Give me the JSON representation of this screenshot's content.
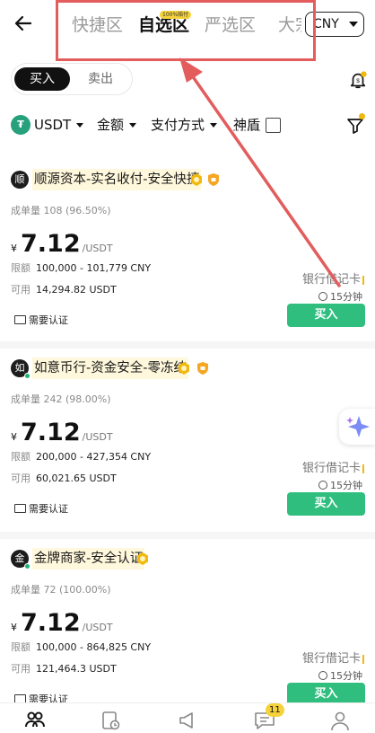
{
  "header": {
    "tabs": [
      {
        "label": "快捷区",
        "active": false
      },
      {
        "label": "自选区",
        "active": true
      },
      {
        "label": "严选区",
        "active": false,
        "badge": "100%赔付"
      },
      {
        "label": "大宗",
        "active": false
      }
    ],
    "currency": "CNY"
  },
  "trade_toggle": {
    "buy_label": "买入",
    "sell_label": "卖出",
    "selected": "买入"
  },
  "filters": {
    "asset": "USDT",
    "amount": "金额",
    "payment": "支付方式",
    "shield": "神盾",
    "shield_checked": false
  },
  "listings": [
    {
      "avatar_char": "顺",
      "merchant": "顺源资本-实名收付-安全快捷",
      "orders": "成单量 108 (96.50%)",
      "currency_symbol": "¥",
      "price": "7.12",
      "price_unit": "/USDT",
      "limit_label": "限额",
      "limit": "100,000 - 101,779 CNY",
      "available_label": "可用",
      "available": "14,294.82 USDT",
      "payment_method": "银行借记卡",
      "eta": "15分钟",
      "verify": "需要认证",
      "buy_label": "买入",
      "badge_count": 2
    },
    {
      "avatar_char": "如",
      "merchant": "如意币行-资金安全-零冻结",
      "orders": "成单量 242 (98.00%)",
      "currency_symbol": "¥",
      "price": "7.12",
      "price_unit": "/USDT",
      "limit_label": "限额",
      "limit": "200,000 - 427,354 CNY",
      "available_label": "可用",
      "available": "60,021.65 USDT",
      "payment_method": "银行借记卡",
      "eta": "15分钟",
      "verify": "需要认证",
      "buy_label": "买入",
      "badge_count": 2
    },
    {
      "avatar_char": "金",
      "merchant": "金牌商家-安全认证",
      "orders": "成单量 72 (100.00%)",
      "currency_symbol": "¥",
      "price": "7.12",
      "price_unit": "/USDT",
      "limit_label": "限额",
      "limit": "100,000 - 864,825 CNY",
      "available_label": "可用",
      "available": "121,464.3 USDT",
      "payment_method": "银行借记卡",
      "eta": "15分钟",
      "verify": "需要认证",
      "buy_label": "买入",
      "badge_count": 1
    }
  ],
  "bottom_nav": {
    "items": [
      "p2p-icon",
      "orders-icon",
      "announcements-icon",
      "chat-icon",
      "profile-icon"
    ],
    "chat_badge": "11"
  },
  "colors": {
    "accent_green": "#2fbe7e",
    "highlight_bg": "#fff8dc",
    "annotation_red": "#e35d5d",
    "brand_yellow": "#f0b90b"
  }
}
